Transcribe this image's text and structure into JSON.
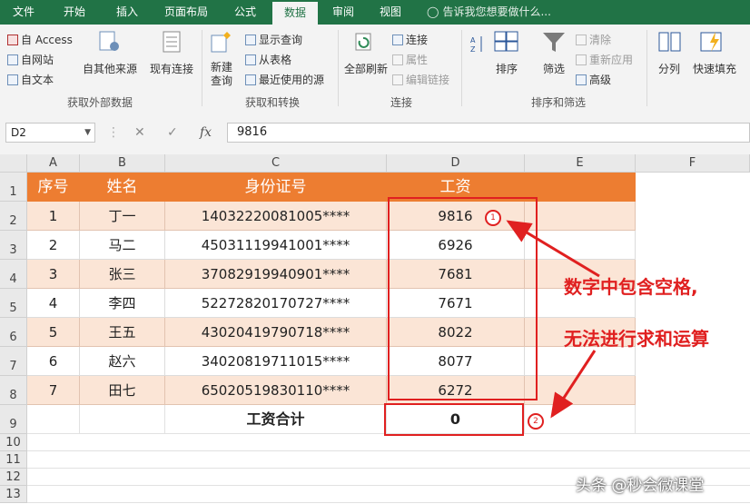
{
  "tabs": [
    "文件",
    "开始",
    "插入",
    "页面布局",
    "公式",
    "数据",
    "审阅",
    "视图"
  ],
  "active_tab": "数据",
  "tell_me": "告诉我您想要做什么...",
  "ribbon": {
    "external": {
      "access": "自 Access",
      "web": "自网站",
      "text": "自文本",
      "other": "自其他来源",
      "existing": "现有连接",
      "label": "获取外部数据"
    },
    "transform": {
      "new_query": "新建",
      "new_query2": "查询",
      "show_queries": "显示查询",
      "from_table": "从表格",
      "recent": "最近使用的源",
      "label": "获取和转换"
    },
    "connections": {
      "refresh_all": "全部刷新",
      "connections": "连接",
      "properties": "属性",
      "edit_links": "编辑链接",
      "label": "连接"
    },
    "sort": {
      "sort": "排序",
      "filter": "筛选",
      "clear": "清除",
      "reapply": "重新应用",
      "advanced": "高级",
      "label": "排序和筛选"
    },
    "tools": {
      "split": "分列",
      "flash_fill": "快速填充"
    }
  },
  "name_box": "D2",
  "formula_value": "9816",
  "columns": [
    "A",
    "B",
    "C",
    "D",
    "E",
    "F"
  ],
  "rows": [
    "1",
    "2",
    "3",
    "4",
    "5",
    "6",
    "7",
    "8",
    "9",
    "10",
    "11",
    "12",
    "13"
  ],
  "table": {
    "headers": [
      "序号",
      "姓名",
      "身份证号",
      "工资"
    ],
    "data": [
      [
        "1",
        "丁一",
        "14032220081005****",
        "9816"
      ],
      [
        "2",
        "马二",
        "45031119941001****",
        "6926"
      ],
      [
        "3",
        "张三",
        "37082919940901****",
        "7681"
      ],
      [
        "4",
        "李四",
        "52272820170727****",
        "7671"
      ],
      [
        "5",
        "王五",
        "43020419790718****",
        "8022"
      ],
      [
        "6",
        "赵六",
        "34020819711015****",
        "8077"
      ],
      [
        "7",
        "田七",
        "65020519830110****",
        "6272"
      ]
    ],
    "total_label": "工资合计",
    "total_value": "0"
  },
  "annotations": {
    "marker1": "1",
    "marker2": "2",
    "line1": "数字中包含空格,",
    "line2": "无法进行求和运算"
  },
  "watermark": "头条 @秒会微课堂",
  "colors": {
    "accent": "#217346",
    "header": "#ed7d31",
    "band": "#fbe5d6",
    "annotation": "#e02020"
  }
}
